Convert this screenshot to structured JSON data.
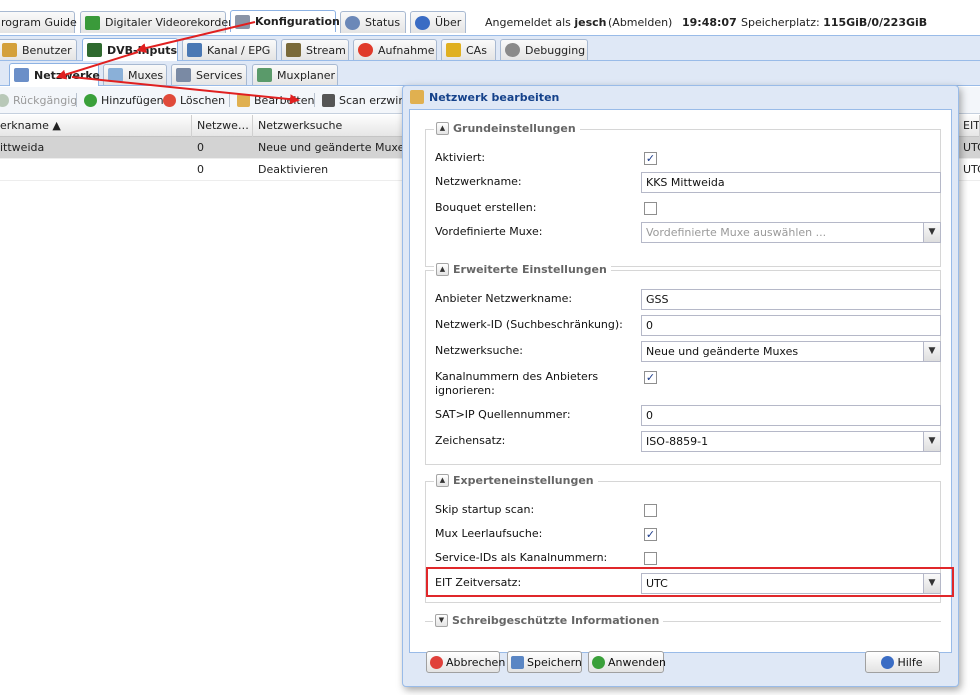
{
  "colors": {
    "accent": "#99bbe8",
    "highlight": "#e0272a",
    "arrow": "#e02020",
    "selected_row": "#d3d3d3"
  },
  "top_tabs": [
    {
      "label": "rogram Guide",
      "icon": "program-guide-icon"
    },
    {
      "label": "Digitaler Videorekorder",
      "icon": "download-icon"
    },
    {
      "label": "Konfiguration",
      "icon": "wrench-icon"
    },
    {
      "label": "Status",
      "icon": "eye-icon"
    },
    {
      "label": "Über",
      "icon": "info-icon"
    }
  ],
  "status": {
    "logged_in_prefix": "Angemeldet als",
    "user": "jesch",
    "logout": "(Abmelden)",
    "time": "19:48:07",
    "storage_label": "Speicherplatz:",
    "storage_value": "115GiB/0/223GiB"
  },
  "config_tabs": [
    {
      "label": "Benutzer",
      "icon": "users-icon"
    },
    {
      "label": "DVB-Inputs",
      "icon": "dvb-card-icon"
    },
    {
      "label": "Kanal / EPG",
      "icon": "tv-icon"
    },
    {
      "label": "Stream",
      "icon": "stream-icon"
    },
    {
      "label": "Aufnahme",
      "icon": "record-icon"
    },
    {
      "label": "CAs",
      "icon": "key-icon"
    },
    {
      "label": "Debugging",
      "icon": "gears-icon"
    }
  ],
  "dvb_tabs": [
    {
      "label": "Netzwerke",
      "icon": "antenna-icon"
    },
    {
      "label": "Muxes",
      "icon": "satellite-icon"
    },
    {
      "label": "Services",
      "icon": "services-icon"
    },
    {
      "label": "Muxplaner",
      "icon": "scheduler-icon"
    }
  ],
  "toolbar": {
    "undo": "Rückgängig",
    "add": "Hinzufügen",
    "delete": "Löschen",
    "edit": "Bearbeiten",
    "scan": "Scan erzwing"
  },
  "grid": {
    "columns": [
      "erkname ▲",
      "Netzwe…",
      "Netzwerksuche",
      "EIT"
    ],
    "rows": [
      {
        "name": "ittweida",
        "count": "0",
        "search": "Neue und geänderte Muxes",
        "eit": "UTC"
      },
      {
        "name": "",
        "count": "0",
        "search": "Deaktivieren",
        "eit": "UTC"
      }
    ]
  },
  "dialog": {
    "title": "Netzwerk bearbeiten",
    "sections": {
      "basic": {
        "legend": "Grundeinstellungen",
        "enabled_label": "Aktiviert:",
        "enabled": true,
        "name_label": "Netzwerkname:",
        "name_value": "KKS Mittweida",
        "bouquet_label": "Bouquet erstellen:",
        "bouquet": false,
        "predef_label": "Vordefinierte Muxe:",
        "predef_placeholder": "Vordefinierte Muxe auswählen ..."
      },
      "advanced": {
        "legend": "Erweiterte Einstellungen",
        "provider_label": "Anbieter Netzwerkname:",
        "provider_value": "GSS",
        "netid_label": "Netzwerk-ID (Suchbeschränkung):",
        "netid_value": "0",
        "discovery_label": "Netzwerksuche:",
        "discovery_value": "Neue und geänderte Muxes",
        "ignore_label_1": "Kanalnummern des Anbieters",
        "ignore_label_2": "ignorieren:",
        "ignore": true,
        "satip_label": "SAT>IP Quellennummer:",
        "satip_value": "0",
        "charset_label": "Zeichensatz:",
        "charset_value": "ISO-8859-1"
      },
      "expert": {
        "legend": "Experteneinstellungen",
        "skip_label": "Skip startup scan:",
        "skip": false,
        "idle_label": "Mux Leerlaufsuche:",
        "idle": true,
        "sid_label": "Service-IDs als Kanalnummern:",
        "sid": false,
        "eit_label": "EIT Zeitversatz:",
        "eit_value": "UTC"
      },
      "readonly": {
        "legend": "Schreibgeschützte Informationen"
      }
    },
    "buttons": {
      "cancel": "Abbrechen",
      "save": "Speichern",
      "apply": "Anwenden",
      "help": "Hilfe"
    }
  }
}
